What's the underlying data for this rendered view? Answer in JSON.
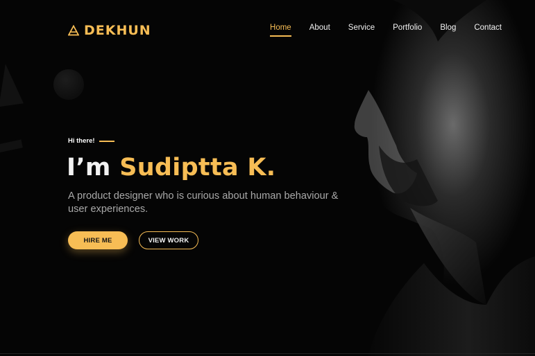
{
  "brand": {
    "name": "DEKHUN",
    "icon": "triangle-logo-icon",
    "color": "#f7bd55"
  },
  "nav": [
    {
      "label": "Home",
      "active": true
    },
    {
      "label": "About",
      "active": false
    },
    {
      "label": "Service",
      "active": false
    },
    {
      "label": "Portfolio",
      "active": false
    },
    {
      "label": "Blog",
      "active": false
    },
    {
      "label": "Contact",
      "active": false
    }
  ],
  "hero": {
    "eyebrow": "Hi there!",
    "headline_prefix": "I’m ",
    "headline_name": "Sudiptta K.",
    "tagline": "A product designer who is curious about human behaviour & user experiences.",
    "primary_button": "HIRE ME",
    "secondary_button": "VIEW WORK"
  },
  "colors": {
    "accent": "#f7bd55",
    "background": "#050505",
    "text": "#f2f2f2",
    "muted": "#a9a9a9"
  }
}
